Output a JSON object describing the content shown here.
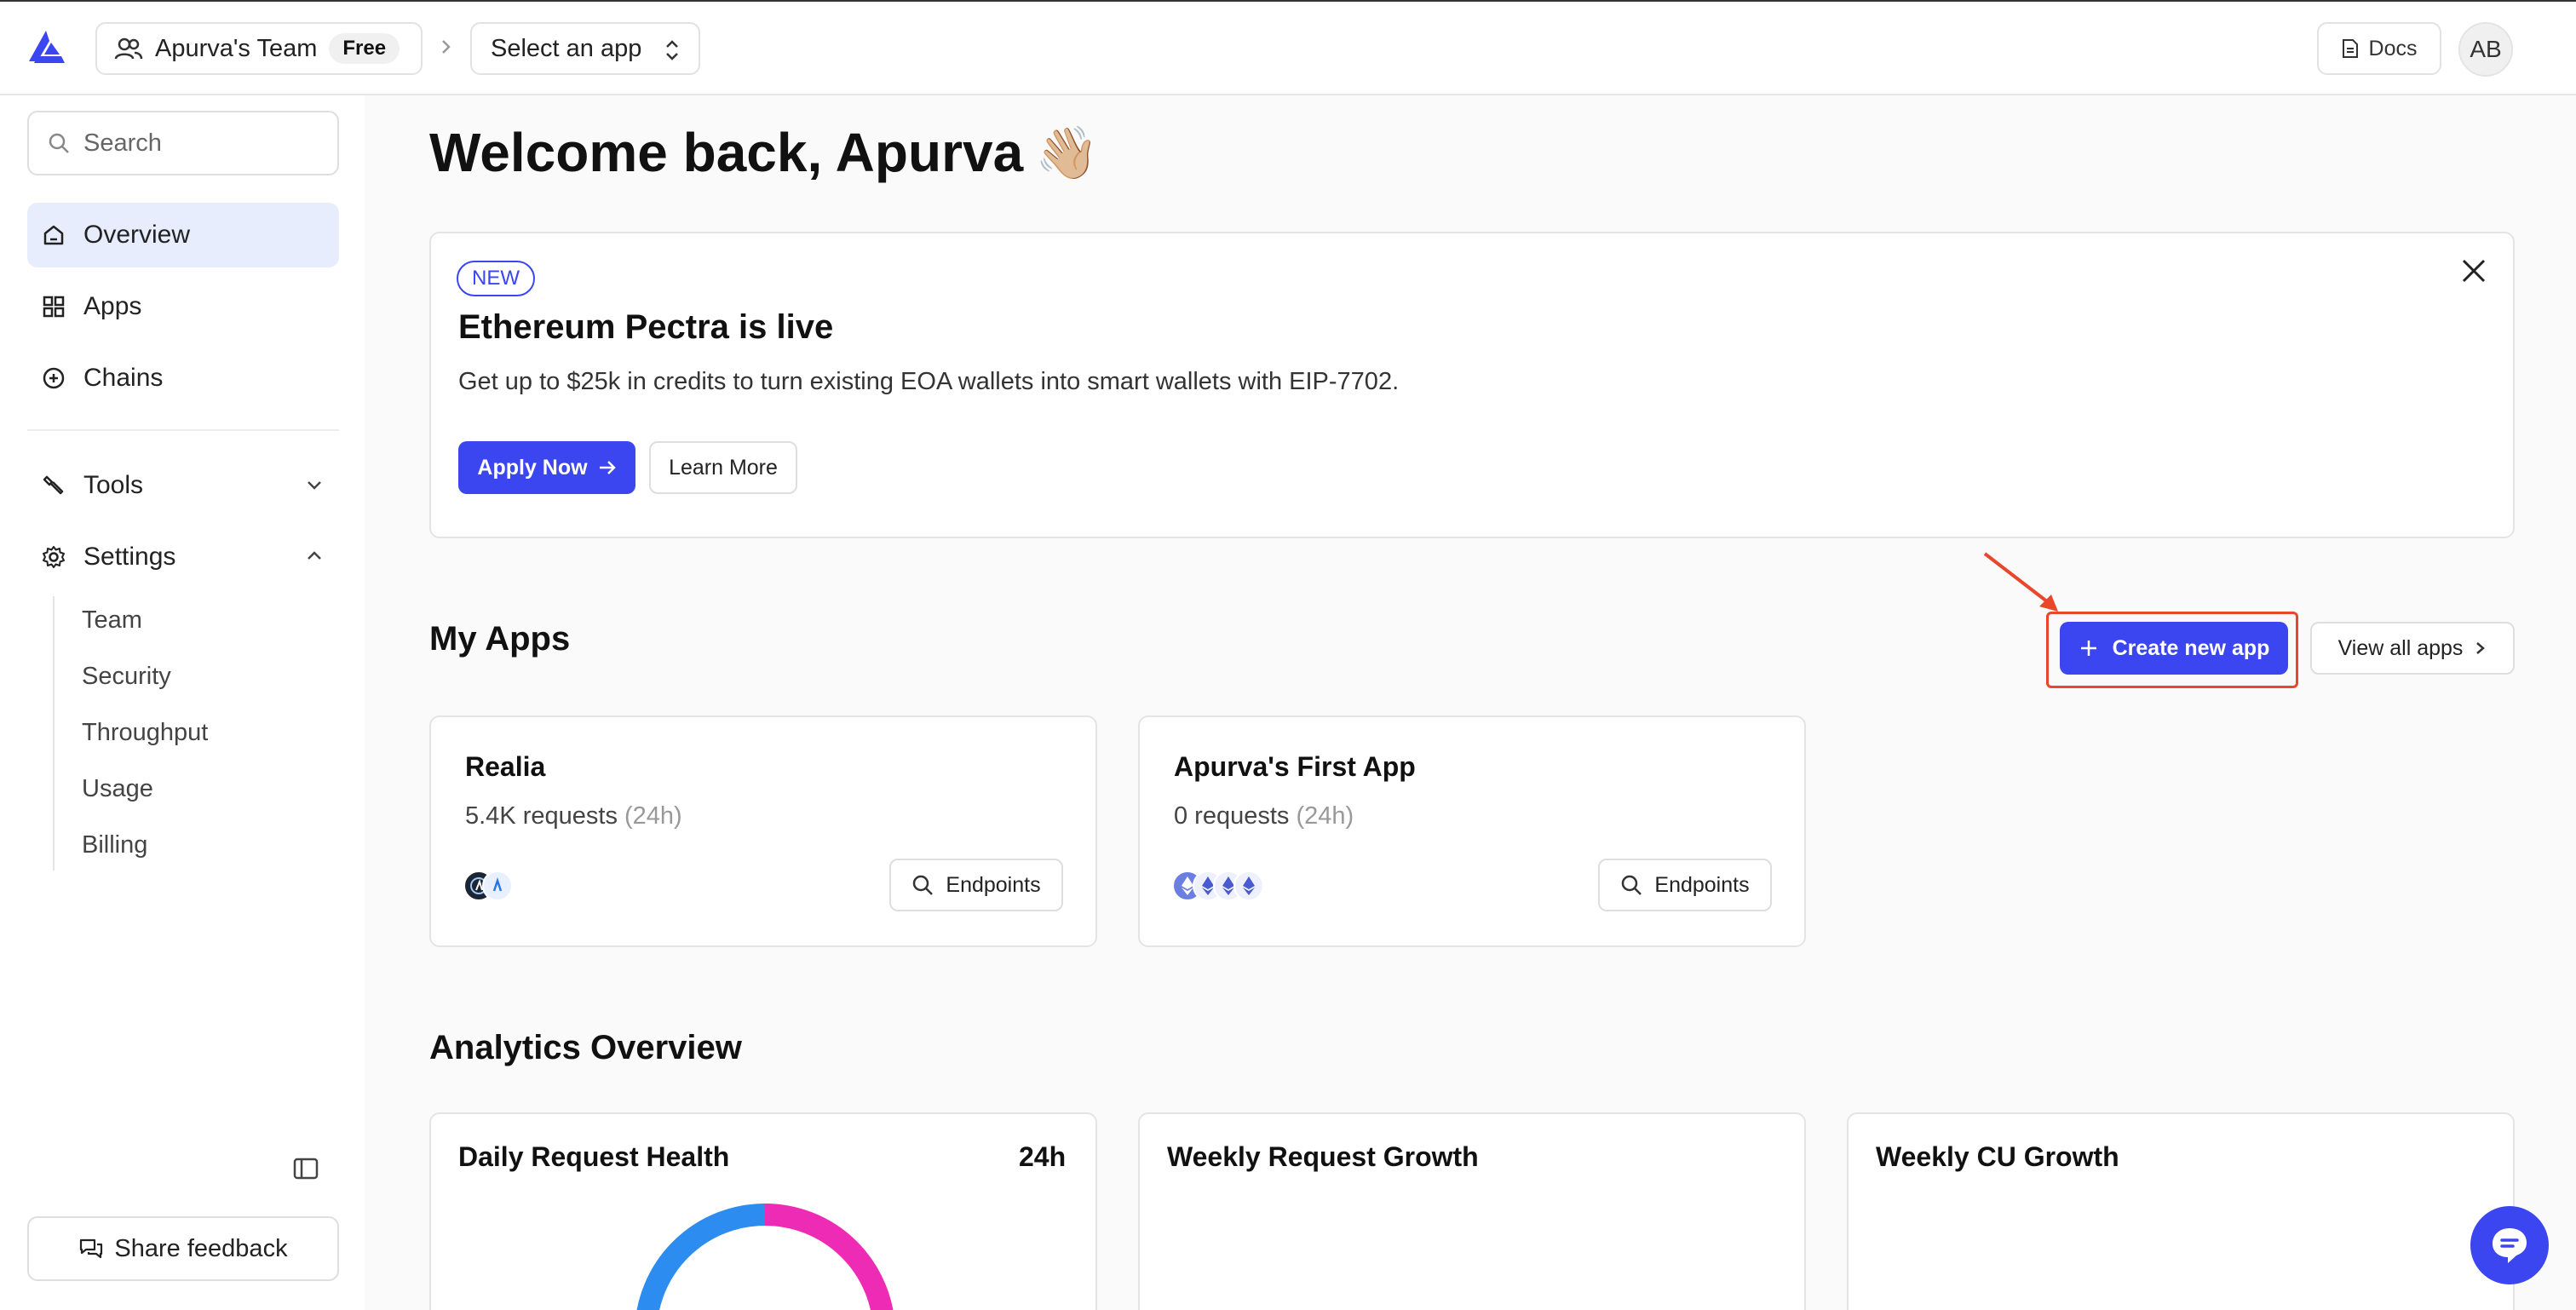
{
  "header": {
    "team_name": "Apurva's Team",
    "plan_badge": "Free",
    "app_select_placeholder": "Select an app",
    "docs_label": "Docs",
    "avatar_initials": "AB"
  },
  "sidebar": {
    "search_placeholder": "Search",
    "nav": [
      {
        "label": "Overview",
        "icon": "home-icon",
        "active": true
      },
      {
        "label": "Apps",
        "icon": "grid-icon"
      },
      {
        "label": "Chains",
        "icon": "plus-circle-icon"
      },
      {
        "label": "Tools",
        "icon": "wrench-icon",
        "expanded": false
      },
      {
        "label": "Settings",
        "icon": "gear-icon",
        "expanded": true
      }
    ],
    "settings_items": [
      "Team",
      "Security",
      "Throughput",
      "Usage",
      "Billing"
    ],
    "feedback_label": "Share feedback"
  },
  "main": {
    "welcome": "Welcome back, Apurva",
    "welcome_emoji": "👋🏼",
    "banner": {
      "badge": "NEW",
      "title": "Ethereum Pectra is live",
      "description": "Get up to $25k in credits to turn existing EOA wallets into smart wallets with EIP-7702.",
      "apply_label": "Apply Now",
      "learn_label": "Learn More"
    },
    "my_apps": {
      "title": "My Apps",
      "create_label": "Create new app",
      "view_all_label": "View all apps",
      "apps": [
        {
          "name": "Realia",
          "requests": "5.4K requests",
          "period": "(24h)",
          "endpoints_label": "Endpoints"
        },
        {
          "name": "Apurva's First App",
          "requests": "0 requests",
          "period": "(24h)",
          "endpoints_label": "Endpoints"
        }
      ]
    },
    "analytics": {
      "title": "Analytics Overview",
      "cards": [
        {
          "title": "Daily Request Health",
          "period": "24h"
        },
        {
          "title": "Weekly Request Growth"
        },
        {
          "title": "Weekly CU Growth"
        }
      ]
    }
  },
  "colors": {
    "accent": "#3b46f1",
    "highlight_outline": "#e8472c",
    "active_nav_bg": "#e8edfd",
    "donut_blue": "#2d8cf0",
    "donut_pink": "#ee2bb5"
  }
}
